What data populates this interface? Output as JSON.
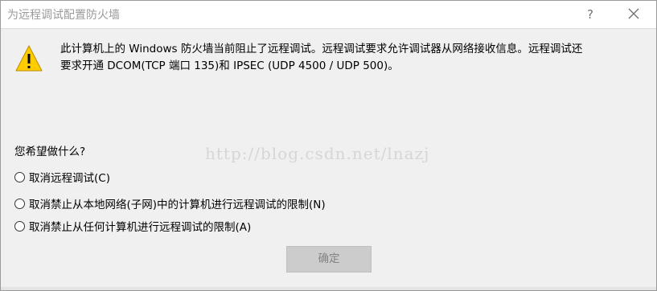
{
  "window": {
    "title": "为远程调试配置防火墙",
    "help_label": "?",
    "close_icon": "close-icon"
  },
  "message": {
    "icon": "warning-icon",
    "line1": "此计算机上的 Windows 防火墙当前阻止了远程调试。远程调试要求允许调试器从网络接收信息。远程调试还",
    "line2": "要求开通 DCOM(TCP 端口 135)和 IPSEC (UDP 4500 / UDP 500)。"
  },
  "question": "您希望做什么?",
  "watermark": "http://blog.csdn.net/lnazj",
  "options": [
    {
      "label": "取消远程调试(C)",
      "selected": false
    },
    {
      "label": "取消禁止从本地网络(子网)中的计算机进行远程调试的限制(N)",
      "selected": false
    },
    {
      "label": "取消禁止从任何计算机进行远程调试的限制(A)",
      "selected": false
    }
  ],
  "buttons": {
    "ok_label": "确定",
    "ok_enabled": false
  },
  "colors": {
    "warning_fill": "#FFCC00",
    "dialog_background": "#F0F0F0",
    "disabled_button": "#CCCCCC"
  }
}
